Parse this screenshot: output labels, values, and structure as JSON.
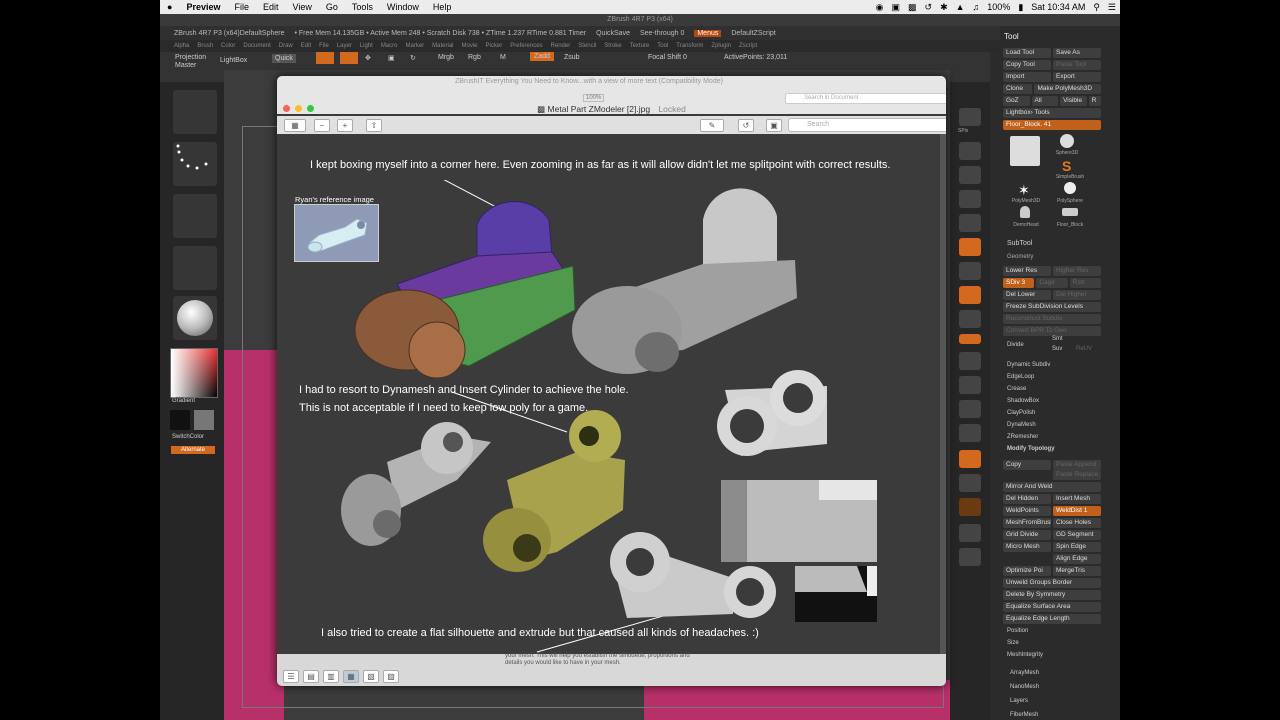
{
  "menubar": {
    "apple": "",
    "app": "Preview",
    "items": [
      "File",
      "Edit",
      "View",
      "Go",
      "Tools",
      "Window",
      "Help"
    ],
    "battery": "100%",
    "clock": "Sat 10:34 AM"
  },
  "zbrush": {
    "window_title": "ZBrush 4R7 P3 (x64)",
    "info_left": "ZBrush 4R7 P3 (x64)DefaultSphere",
    "info_stats": "• Free Mem 14.135GB • Active Mem 248 • Scratch Disk 738 • ZTime 1.237 RTime 0.881 Timer",
    "quicksave": "QuickSave",
    "see_through": "See-through 0",
    "menus_label": "Menus",
    "default_script": "DefaultZScript",
    "menu_items": [
      "Alpha",
      "Brush",
      "Color",
      "Document",
      "Draw",
      "Edit",
      "File",
      "Layer",
      "Light",
      "Macro",
      "Marker",
      "Material",
      "Movie",
      "Picker",
      "Preferences",
      "Render",
      "Stencil",
      "Stroke",
      "Texture",
      "Tool",
      "Transform",
      "Zplugin",
      "Zscript"
    ],
    "shelf": {
      "projection_master": "Projection Master",
      "lightbox": "LightBox",
      "quick": "Quick",
      "mrgb": "Mrgb",
      "rgb": "Rgb",
      "m": "M",
      "zadd": "Zadd",
      "zsub": "Zsub",
      "focal_shift": "Focal Shift 0",
      "active_points": "ActivePoints: 23,011"
    },
    "left_panel": {
      "gradient": "Gradient",
      "switch_color": "SwitchColor",
      "alternate": "Alternate"
    },
    "right_shelf": [
      "Bpr",
      "SPix",
      "Scroll",
      "Zoom",
      "Actual",
      "AAHalf",
      "Persp",
      "Floor",
      "Local",
      "L.Sym",
      "Gxyz",
      "Frame",
      "Move",
      "Scale",
      "Rotate",
      "PolyF",
      "Transp",
      "Solo",
      "Xpose"
    ],
    "tool_panel": {
      "title": "Tool",
      "load_tool": "Load Tool",
      "save_as": "Save As",
      "copy_tool": "Copy Tool",
      "paste_tool": "Paste Tool",
      "import": "Import",
      "export": "Export",
      "clone": "Clone",
      "make_polymesh": "Make PolyMesh3D",
      "goz": "GoZ",
      "all": "All",
      "visible": "Visible",
      "r": "R",
      "lightbox_tools": "Lightbox› Tools",
      "floor_block": "Floor_Block. 41",
      "thumbs": [
        "Sphere3D",
        "SimpleBrush",
        "PolyMesh3D",
        "PolySphere",
        "DemoHead",
        "Floor_Block"
      ],
      "subtool": "SubTool",
      "geometry": "Geometry",
      "lower_res": "Lower Res",
      "higher_res": "Higher Res",
      "sdiv": "SDiv 3",
      "cage": "Cage",
      "rstr": "Rstr",
      "del_lower": "Del Lower",
      "del_higher": "Del Higher",
      "freeze_subdivision": "Freeze SubDivision Levels",
      "reconstruct_subdiv": "Reconstruct Subdiv",
      "convert_bpr": "Convert BPR To Geo",
      "divide": "Divide",
      "smt": "Smt",
      "suv": "Suv",
      "reuv": "ReUV",
      "list": [
        "Dynamic Subdiv",
        "EdgeLoop",
        "Crease",
        "ShadowBox",
        "ClayPolish",
        "DynaMesh",
        "ZRemesher"
      ],
      "modify_topology": "Modify Topology",
      "copy": "Copy",
      "paste_append": "Paste Append",
      "paste_replace": "Paste Replace",
      "mirror_and_weld": "Mirror And Weld",
      "del_hidden": "Del Hidden",
      "insert_mesh": "Insert Mesh",
      "weld_points": "WeldPoints",
      "weld_dist": "WeldDist 1",
      "mesh_from_brush": "MeshFromBrush",
      "close_holes": "Close Holes",
      "grid_divide": "Grid Divide",
      "gd_segments": "GD Segment",
      "micro_mesh": "Micro Mesh",
      "spin_edge": "Spin Edge",
      "align_edge": "Align Edge",
      "optimize_points": "Optimize Poi",
      "merge_tris": "MergeTris",
      "unweld_groups_border": "Unweld Groups Border",
      "delete_by_symmetry": "Delete By Symmetry",
      "equalize_surface_area": "Equalize Surface Area",
      "equalize_edge_length": "Equalize Edge Length",
      "position": "Position",
      "size": "Size",
      "mesh_integrity": "MeshIntegrity",
      "array_mesh": "ArrayMesh",
      "nano_mesh": "NanoMesh",
      "layers": "Layers",
      "fiber_mesh": "FiberMesh"
    }
  },
  "preview": {
    "background_title": "ZBrushIT Everything You Need to Know...with a view of more text (Compatibility Mode)",
    "zoom": "100%",
    "title": "Metal Part ZModeler [2].jpg",
    "locked": "Locked",
    "search_placeholder": "Search",
    "search_in_doc": "Search in Document",
    "caption_top": "I kept boxing myself into a corner here. Even zooming in as far as it will allow didn't let me splitpoint with correct results.",
    "ref_label": "Ryan's reference image",
    "caption_mid_1": "I had to resort to Dynamesh and Insert Cylinder to achieve the hole.",
    "caption_mid_2": "This is not acceptable if I need to keep low poly for a game.",
    "caption_bottom": "I also tried to create a flat silhouette and extrude but that caused all kinds of headaches. :)",
    "bottom_text_1": "your mesh. This will help you establish the silhouette, proportions and",
    "bottom_text_2": "details you would like to have in your mesh."
  }
}
